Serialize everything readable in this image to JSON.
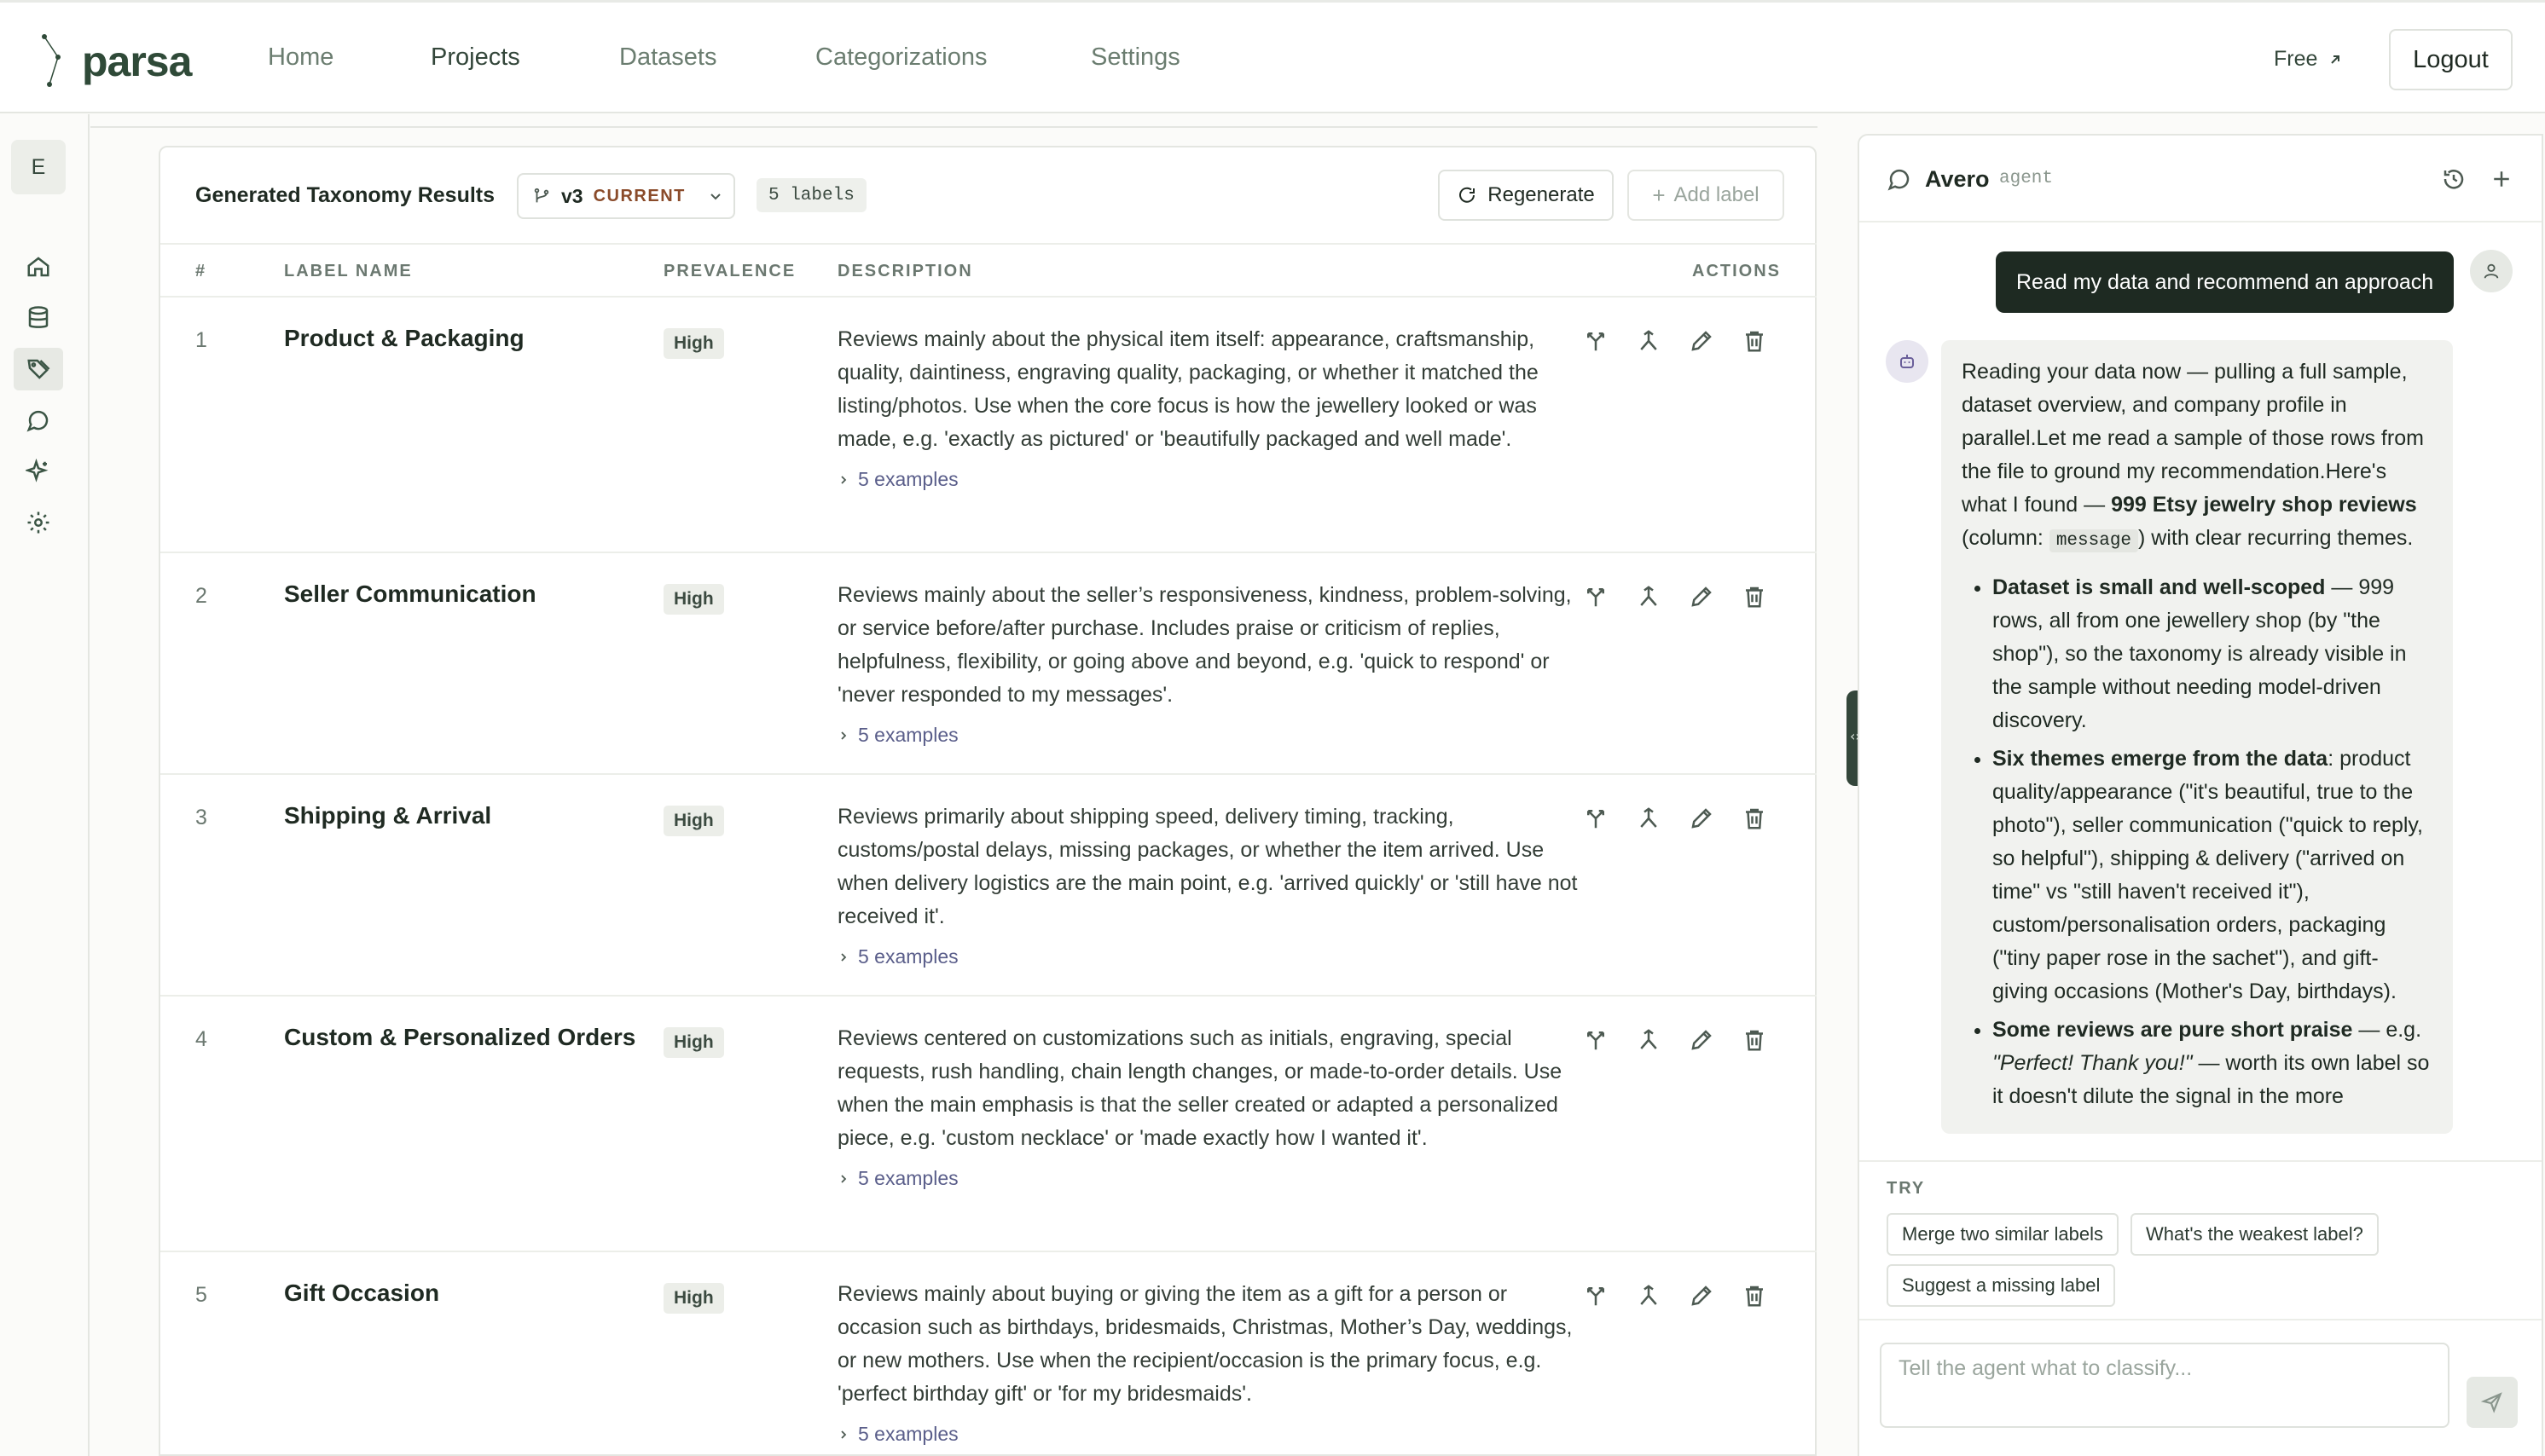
{
  "app": {
    "name": "parsa"
  },
  "nav": {
    "items": [
      "Home",
      "Projects",
      "Datasets",
      "Categorizations",
      "Settings"
    ],
    "active": "Projects"
  },
  "header": {
    "plan_label": "Free",
    "logout_label": "Logout"
  },
  "sidebar": {
    "avatar_initial": "E",
    "icons": [
      "home-icon",
      "database-icon",
      "tags-icon",
      "chat-icon",
      "sparkles-icon",
      "gear-icon"
    ],
    "active_icon": "tags-icon"
  },
  "results": {
    "title": "Generated Taxonomy Results",
    "version": "v3",
    "version_status": "CURRENT",
    "label_count": "5 labels",
    "regenerate_label": "Regenerate",
    "add_label": "Add label",
    "columns": {
      "num": "#",
      "name": "LABEL NAME",
      "prevalence": "PREVALENCE",
      "description": "DESCRIPTION",
      "actions": "ACTIONS"
    },
    "rows": [
      {
        "num": "1",
        "name": "Product & Packaging",
        "prevalence": "High",
        "description": "Reviews mainly about the physical item itself: appearance, craftsmanship, quality, daintiness, engraving quality, packaging, or whether it matched the listing/photos. Use when the core focus is how the jewellery looked or was made, e.g. 'exactly as pictured' or 'beautifully packaged and well made'.",
        "examples": "5 examples"
      },
      {
        "num": "2",
        "name": "Seller Communication",
        "prevalence": "High",
        "description": "Reviews mainly about the seller’s responsiveness, kindness, problem-solving, or service before/after purchase. Includes praise or criticism of replies, helpfulness, flexibility, or going above and beyond, e.g. 'quick to respond' or 'never responded to my messages'.",
        "examples": "5 examples"
      },
      {
        "num": "3",
        "name": "Shipping & Arrival",
        "prevalence": "High",
        "description": "Reviews primarily about shipping speed, delivery timing, tracking, customs/postal delays, missing packages, or whether the item arrived. Use when delivery logistics are the main point, e.g. 'arrived quickly' or 'still have not received it'.",
        "examples": "5 examples"
      },
      {
        "num": "4",
        "name": "Custom & Personalized Orders",
        "prevalence": "High",
        "description": "Reviews centered on customizations such as initials, engraving, special requests, rush handling, chain length changes, or made-to-order details. Use when the main emphasis is that the seller created or adapted a personalized piece, e.g. 'custom necklace' or 'made exactly how I wanted it'.",
        "examples": "5 examples"
      },
      {
        "num": "5",
        "name": "Gift Occasion",
        "prevalence": "High",
        "description": "Reviews mainly about buying or giving the item as a gift for a person or occasion such as birthdays, bridesmaids, Christmas, Mother’s Day, weddings, or new mothers. Use when the recipient/occasion is the primary focus, e.g. 'perfect birthday gift' or 'for my bridesmaids'.",
        "examples": "5 examples"
      }
    ]
  },
  "chat": {
    "agent_name": "Avero",
    "agent_role": "agent",
    "user_message": "Read my data and recommend an approach",
    "bot_intro_1": "Reading your data now — pulling a full sample, dataset overview, and company profile in parallel.Let me read a sample of those rows from the file to ground my recommendation.Here's what I found — ",
    "bot_intro_bold": "999 Etsy jewelry shop reviews",
    "bot_intro_2": " (column: ",
    "bot_intro_code": "message",
    "bot_intro_3": ") with clear recurring themes.",
    "bullets": [
      {
        "bold": "Dataset is small and well-scoped",
        "text": " — 999 rows, all from one jewellery shop (by \"the shop\"), so the taxonomy is already visible in the sample without needing model-driven discovery."
      },
      {
        "bold": "Six themes emerge from the data",
        "text": ": product quality/appearance (\"it's beautiful, true to the photo\"), seller communication (\"quick to reply, so helpful\"), shipping & delivery (\"arrived on time\" vs \"still haven't received it\"), custom/personalisation orders, packaging (\"tiny paper rose in the sachet\"), and gift-giving occasions (Mother's Day, birthdays)."
      },
      {
        "bold": "Some reviews are pure short praise",
        "text": " — e.g. ",
        "italic": "\"Perfect! Thank you!\"",
        "text2": " — worth its own label so it doesn't dilute the signal in the more"
      }
    ],
    "try_label": "TRY",
    "suggestions": [
      "Merge two similar labels",
      "What's the weakest label?",
      "Suggest a missing label"
    ],
    "input_placeholder": "Tell the agent what to classify..."
  }
}
